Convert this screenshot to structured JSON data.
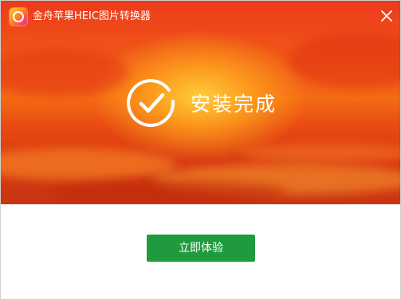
{
  "window": {
    "title": "金舟苹果HEIC图片转换器",
    "app_icon": "app-logo-icon",
    "close_icon": "close-icon"
  },
  "status": {
    "icon": "check-circle-icon",
    "text": "安装完成"
  },
  "actions": {
    "primary_label": "立即体验"
  },
  "colors": {
    "hero_top": "#ec3a1c",
    "hero_glow": "#ffd23c",
    "hero_bottom": "#c93412",
    "button": "#1f9b3e",
    "text_on_hero": "#ffffff"
  }
}
